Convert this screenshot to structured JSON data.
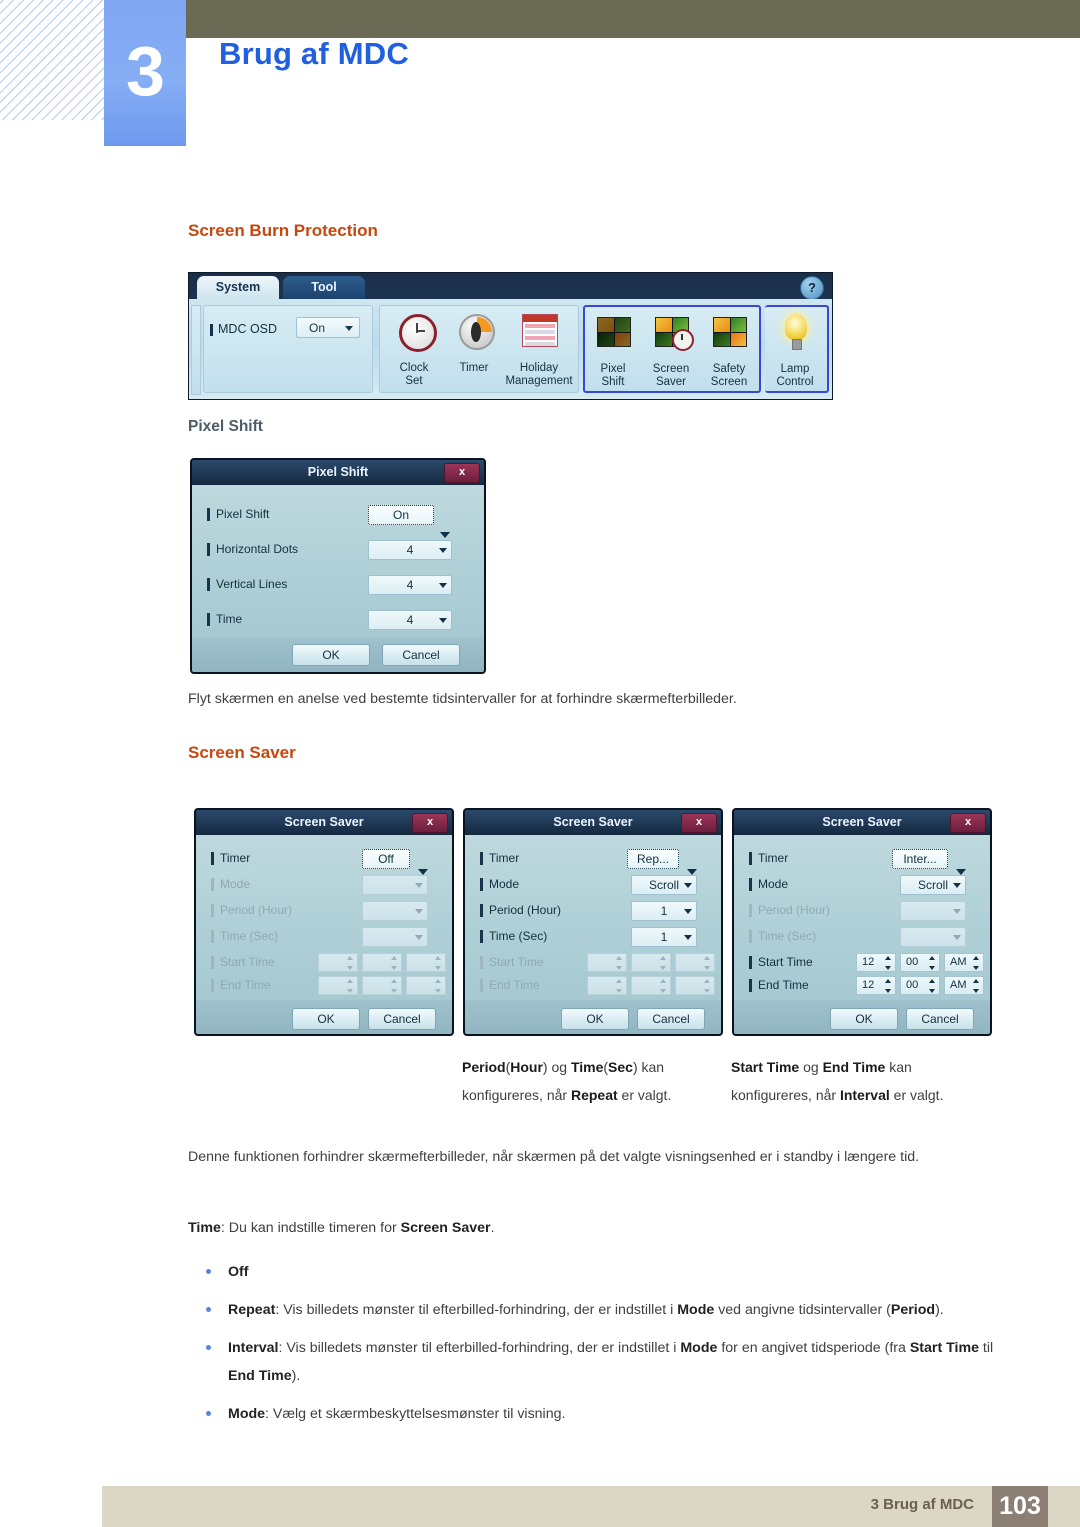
{
  "header": {
    "chapter_number": "3",
    "chapter_title": "Brug af MDC"
  },
  "footer": {
    "text": "3 Brug af MDC",
    "page": "103"
  },
  "sections": {
    "screen_burn_heading": "Screen Burn Protection",
    "pixel_shift_heading": "Pixel Shift",
    "pixel_shift_caption": "Flyt skærmen en anelse ved bestemte tidsintervaller for at forhindre skærmefterbilleder.",
    "screen_saver_heading": "Screen Saver"
  },
  "ribbon": {
    "tabs": [
      {
        "label": "System",
        "active": true
      },
      {
        "label": "Tool",
        "active": false
      }
    ],
    "help_icon": "?",
    "osd": {
      "label": "MDC OSD",
      "value": "On"
    },
    "groups": [
      {
        "name": "clock-group",
        "items": [
          {
            "id": "clock-set",
            "line1": "Clock",
            "line2": "Set",
            "icon": "clock-icon"
          },
          {
            "id": "timer",
            "line1": "Timer",
            "line2": "",
            "icon": "timer-icon"
          },
          {
            "id": "holiday-management",
            "line1": "Holiday",
            "line2": "Management",
            "icon": "calendar-icon"
          }
        ]
      },
      {
        "name": "screen-burn-group",
        "items": [
          {
            "id": "pixel-shift",
            "line1": "Pixel",
            "line2": "Shift",
            "icon": "pixel-shift-icon"
          },
          {
            "id": "screen-saver",
            "line1": "Screen",
            "line2": "Saver",
            "icon": "screen-saver-icon"
          },
          {
            "id": "safety-screen",
            "line1": "Safety",
            "line2": "Screen",
            "icon": "safety-screen-icon"
          }
        ]
      },
      {
        "name": "lamp-group",
        "items": [
          {
            "id": "lamp-control",
            "line1": "Lamp",
            "line2": "Control",
            "icon": "lamp-icon"
          }
        ]
      }
    ]
  },
  "pixel_shift_dialog": {
    "title": "Pixel Shift",
    "close_label": "x",
    "rows": [
      {
        "label": "Pixel Shift",
        "value": "On",
        "enabled": true,
        "focused": true
      },
      {
        "label": "Horizontal Dots",
        "value": "4",
        "enabled": true,
        "focused": false
      },
      {
        "label": "Vertical Lines",
        "value": "4",
        "enabled": true,
        "focused": false
      },
      {
        "label": "Time",
        "value": "4",
        "enabled": true,
        "focused": false
      }
    ],
    "ok_label": "OK",
    "cancel_label": "Cancel"
  },
  "screen_saver_dialogs": [
    {
      "title": "Screen Saver",
      "close_label": "x",
      "rows": [
        {
          "label": "Timer",
          "value": "Off",
          "enabled": true,
          "focused": true,
          "type": "dropdown"
        },
        {
          "label": "Mode",
          "value": "",
          "enabled": false,
          "focused": false,
          "type": "dropdown"
        },
        {
          "label": "Period (Hour)",
          "value": "",
          "enabled": false,
          "focused": false,
          "type": "dropdown"
        },
        {
          "label": "Time (Sec)",
          "value": "",
          "enabled": false,
          "focused": false,
          "type": "dropdown"
        },
        {
          "label": "Start Time",
          "enabled": false,
          "type": "time",
          "hour": "",
          "minute": "",
          "meridiem": ""
        },
        {
          "label": "End Time",
          "enabled": false,
          "type": "time",
          "hour": "",
          "minute": "",
          "meridiem": ""
        }
      ],
      "ok_label": "OK",
      "cancel_label": "Cancel"
    },
    {
      "title": "Screen Saver",
      "close_label": "x",
      "rows": [
        {
          "label": "Timer",
          "value": "Rep...",
          "enabled": true,
          "focused": true,
          "type": "dropdown"
        },
        {
          "label": "Mode",
          "value": "Scroll",
          "enabled": true,
          "focused": false,
          "type": "dropdown"
        },
        {
          "label": "Period (Hour)",
          "value": "1",
          "enabled": true,
          "focused": false,
          "type": "dropdown"
        },
        {
          "label": "Time (Sec)",
          "value": "1",
          "enabled": true,
          "focused": false,
          "type": "dropdown"
        },
        {
          "label": "Start Time",
          "enabled": false,
          "type": "time",
          "hour": "",
          "minute": "",
          "meridiem": ""
        },
        {
          "label": "End Time",
          "enabled": false,
          "type": "time",
          "hour": "",
          "minute": "",
          "meridiem": ""
        }
      ],
      "ok_label": "OK",
      "cancel_label": "Cancel"
    },
    {
      "title": "Screen Saver",
      "close_label": "x",
      "rows": [
        {
          "label": "Timer",
          "value": "Inter...",
          "enabled": true,
          "focused": true,
          "type": "dropdown"
        },
        {
          "label": "Mode",
          "value": "Scroll",
          "enabled": true,
          "focused": false,
          "type": "dropdown"
        },
        {
          "label": "Period (Hour)",
          "value": "",
          "enabled": false,
          "focused": false,
          "type": "dropdown"
        },
        {
          "label": "Time (Sec)",
          "value": "",
          "enabled": false,
          "focused": false,
          "type": "dropdown"
        },
        {
          "label": "Start Time",
          "enabled": true,
          "type": "time",
          "hour": "12",
          "minute": "00",
          "meridiem": "AM"
        },
        {
          "label": "End Time",
          "enabled": true,
          "type": "time",
          "hour": "12",
          "minute": "00",
          "meridiem": "AM"
        }
      ],
      "ok_label": "OK",
      "cancel_label": "Cancel"
    }
  ],
  "captions": {
    "middle": "Period(Hour) og Time(Sec) kan konfigureres, når Repeat er valgt.",
    "right": "Start Time og End Time kan konfigureres, når Interval er valgt."
  },
  "body": {
    "standby_note": "Denne funktionen forhindrer skærmefterbilleder, når skærmen på det valgte visningsenhed er i standby i længere tid.",
    "time_note": "Time: Du kan indstille timeren for Screen Saver.",
    "bullets": [
      "Off",
      "Repeat: Vis billedets mønster til efterbilled-forhindring, der er indstillet i Mode ved angivne tidsintervaller (Period).",
      "Interval: Vis billedets mønster til efterbilled-forhindring, der er indstillet i Mode for en angivet tidsperiode (fra Start Time til End Time).",
      "Mode: Vælg et skærmbeskyttelsesmønster til visning."
    ]
  },
  "colors": {
    "accent_orange": "#c8470f",
    "chapter_blue": "#1f5fe0",
    "top_band": "#6b6a55",
    "footer_band": "#dcd6c4",
    "page_box": "#8b7f73"
  }
}
